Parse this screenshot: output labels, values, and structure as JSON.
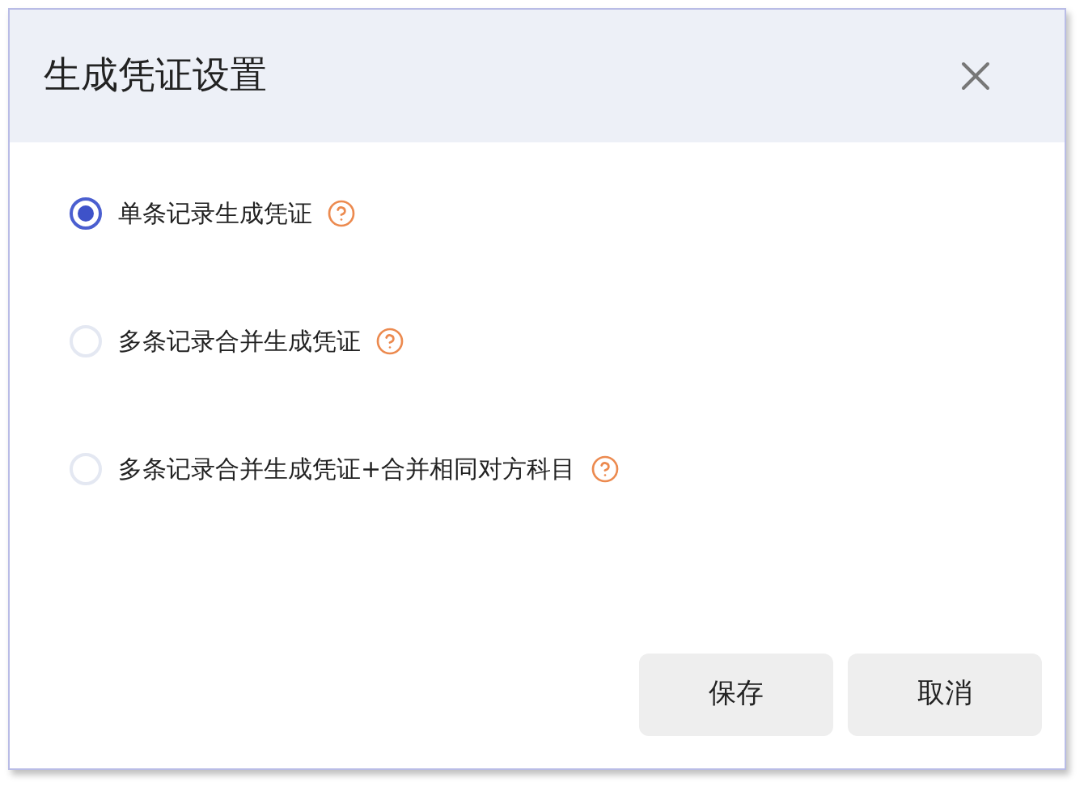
{
  "dialog": {
    "title": "生成凭证设置"
  },
  "options": [
    {
      "label": "单条记录生成凭证",
      "selected": true
    },
    {
      "label": "多条记录合并生成凭证",
      "selected": false
    },
    {
      "label": "多条记录合并生成凭证+合并相同对方科目",
      "selected": false
    }
  ],
  "buttons": [
    "保存",
    "取消"
  ]
}
